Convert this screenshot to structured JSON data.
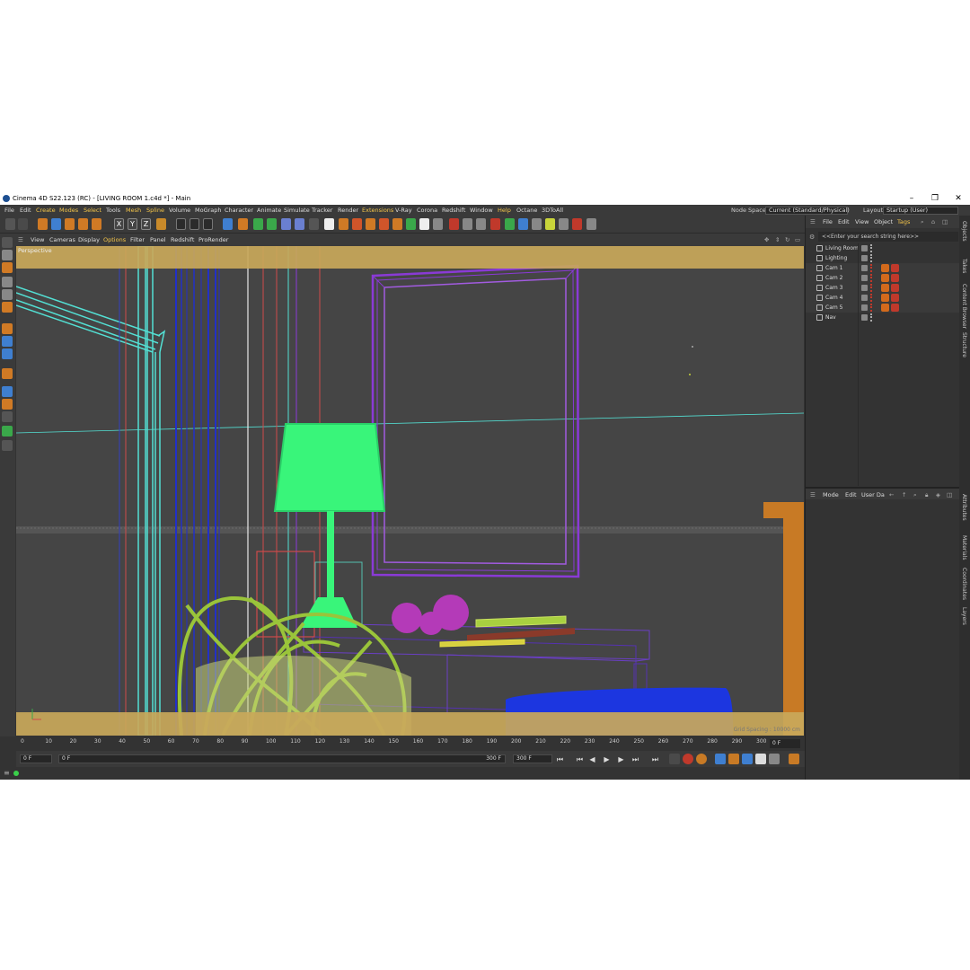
{
  "window": {
    "title": "Cinema 4D S22.123 (RC) - [LIVING ROOM 1.c4d *] - Main",
    "controls": [
      "–",
      "❐",
      "✕"
    ]
  },
  "menubar": {
    "items": [
      "File",
      "Edit",
      "Create",
      "Modes",
      "Select",
      "Tools",
      "Mesh",
      "Spline",
      "Volume",
      "MoGraph",
      "Character",
      "Animate",
      "Simulate",
      "Tracker",
      "Render",
      "Extensions",
      "V-Ray",
      "Corona",
      "Redshift",
      "Window",
      "Help",
      "Octane",
      "3DToAll"
    ],
    "highlighted": [
      "Create",
      "Modes",
      "Select",
      "Mesh",
      "Spline",
      "Extensions",
      "Help"
    ],
    "node_space_label": "Node Space:",
    "node_space_value": "Current (Standard/Physical)",
    "layout_label": "Layout:",
    "layout_value": "Startup (User)"
  },
  "toolbar": {
    "axis_labels": [
      "X",
      "Y",
      "Z"
    ]
  },
  "viewport_menu": {
    "items": [
      "View",
      "Cameras",
      "Display",
      "Options",
      "Filter",
      "Panel",
      "Redshift",
      "ProRender"
    ],
    "highlighted": [
      "Options"
    ]
  },
  "viewport": {
    "label": "Perspective",
    "grid_spacing": "Grid Spacing : 10000 cm"
  },
  "timeline": {
    "ticks": [
      "0",
      "10",
      "20",
      "30",
      "40",
      "50",
      "60",
      "70",
      "80",
      "90",
      "100",
      "110",
      "120",
      "130",
      "140",
      "150",
      "160",
      "170",
      "180",
      "190",
      "200",
      "210",
      "220",
      "230",
      "240",
      "250",
      "260",
      "270",
      "280",
      "290",
      "300"
    ],
    "current_frame": "0 F"
  },
  "playback": {
    "start_frame": "0 F",
    "min_frame": "0 F",
    "max_frame": "300 F",
    "end_frame": "300 F"
  },
  "object_manager": {
    "menu": [
      "File",
      "Edit",
      "View",
      "Object",
      "Tags"
    ],
    "search_placeholder": "<<Enter your search string here>>",
    "objects": [
      {
        "name": "Living Room",
        "tags": 0
      },
      {
        "name": "Lighting",
        "tags": 0
      },
      {
        "name": "Cam 1",
        "tags": 2
      },
      {
        "name": "Cam 2",
        "tags": 2
      },
      {
        "name": "Cam 3",
        "tags": 2
      },
      {
        "name": "Cam 4",
        "tags": 2
      },
      {
        "name": "Cam 5",
        "tags": 2
      },
      {
        "name": "Nav",
        "tags": 0
      }
    ]
  },
  "attributes": {
    "menu": [
      "Mode",
      "Edit",
      "User Da"
    ]
  },
  "side_tabs_top": [
    "Objects",
    "Takes",
    "Content Browser",
    "Structure"
  ],
  "side_tabs_bottom": [
    "Attributes",
    "Materials",
    "Coordinates",
    "Layers"
  ],
  "colors": {
    "safe_frame": "#c9a85a",
    "lamp": "#39f57a",
    "frame": "#8a3ad6",
    "chair": "#9ac43a",
    "cabinet": "#6a3fc4",
    "sofa": "#1c36e0",
    "wall_edges": "#53e0d4",
    "accent": "#f4c54a"
  }
}
